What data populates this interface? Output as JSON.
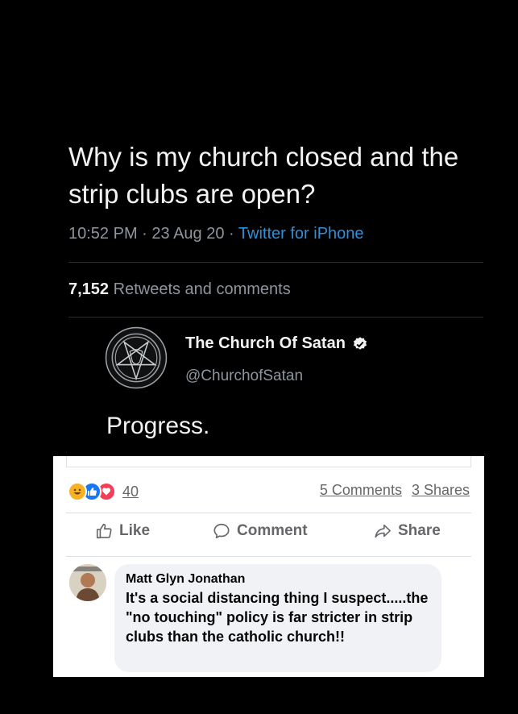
{
  "tweet": {
    "text": "Why is my church closed and the strip clubs are open?",
    "time": "10:52 PM",
    "date": "23 Aug 20",
    "separator": " · ",
    "source": "Twitter for iPhone",
    "retweet_count": "7,152",
    "retweet_label": "Retweets and comments"
  },
  "reply": {
    "account_name": "The Church Of Satan",
    "handle": "@ChurchofSatan",
    "text": "Progress.",
    "logo_icon": "sigil-of-baphomet-icon",
    "verified_icon": "verified-badge-icon"
  },
  "facebook": {
    "reaction_icons": [
      "haha-reaction-icon",
      "like-reaction-icon",
      "love-reaction-icon"
    ],
    "reaction_count": "40",
    "comments_count": "5 Comments",
    "shares_count": "3 Shares",
    "actions": {
      "like": "Like",
      "comment": "Comment",
      "share": "Share"
    },
    "comment": {
      "author": "Matt Glyn Jonathan",
      "text": "It's a social distancing thing I suspect.....the \"no touching\" policy is far stricter in strip clubs than the catholic church!!"
    }
  },
  "colors": {
    "background": "#000000",
    "link_blue": "#2f8fd8",
    "muted_gray": "#8e959c",
    "fb_gray": "#65676b",
    "bubble": "#f0f2f5"
  }
}
